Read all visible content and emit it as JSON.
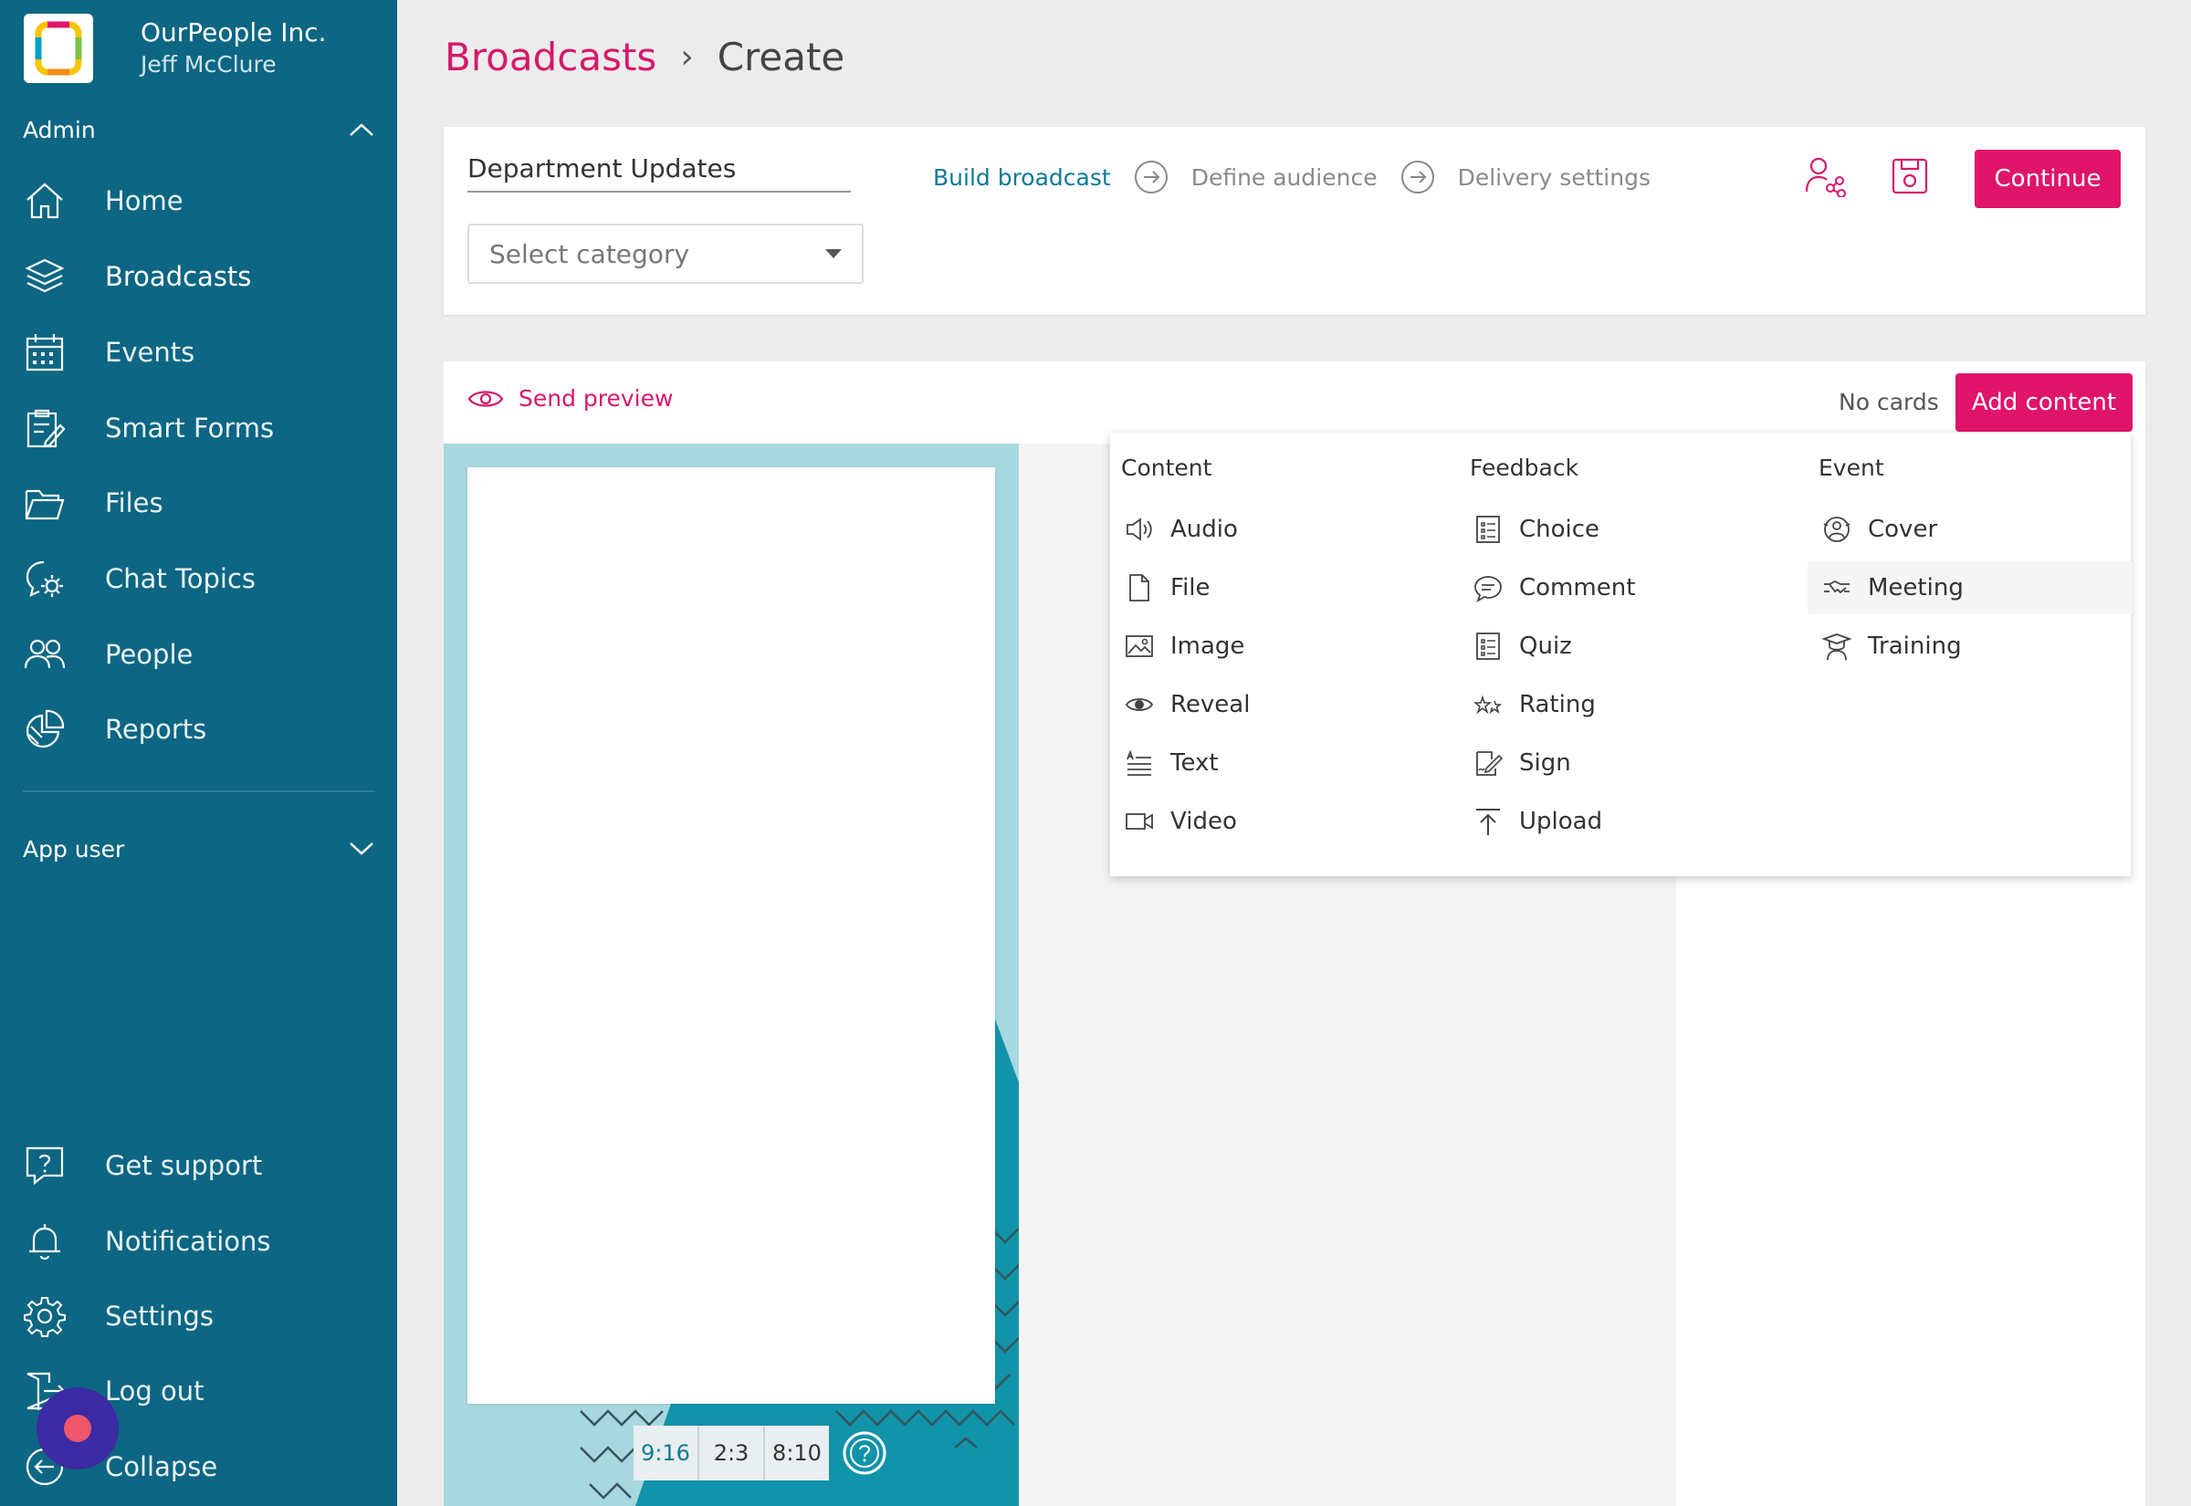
{
  "org": {
    "name": "OurPeople Inc.",
    "user": "Jeff McClure"
  },
  "sidebar": {
    "admin_label": "Admin",
    "items": [
      {
        "label": "Home",
        "icon": "home-icon"
      },
      {
        "label": "Broadcasts",
        "icon": "layers-icon"
      },
      {
        "label": "Events",
        "icon": "calendar-icon"
      },
      {
        "label": "Smart Forms",
        "icon": "form-icon"
      },
      {
        "label": "Files",
        "icon": "folder-icon"
      },
      {
        "label": "Chat Topics",
        "icon": "chat-settings-icon"
      },
      {
        "label": "People",
        "icon": "people-icon"
      },
      {
        "label": "Reports",
        "icon": "pie-chart-icon"
      }
    ],
    "app_user_label": "App user",
    "bottom": [
      {
        "label": "Get support",
        "icon": "help-icon"
      },
      {
        "label": "Notifications",
        "icon": "bell-icon"
      },
      {
        "label": "Settings",
        "icon": "gear-icon"
      },
      {
        "label": "Log out",
        "icon": "logout-icon"
      },
      {
        "label": "Collapse",
        "icon": "collapse-icon"
      }
    ]
  },
  "breadcrumb": {
    "parent": "Broadcasts",
    "current": "Create"
  },
  "form": {
    "title_value": "Department Updates",
    "category_placeholder": "Select category"
  },
  "steps": [
    "Build broadcast",
    "Define audience",
    "Delivery settings"
  ],
  "toolbar": {
    "continue_label": "Continue"
  },
  "content_bar": {
    "send_preview": "Send preview",
    "no_cards": "No cards",
    "add_content": "Add content"
  },
  "ratios": [
    "9:16",
    "2:3",
    "8:10"
  ],
  "dropdown": {
    "columns": [
      {
        "title": "Content",
        "items": [
          "Audio",
          "File",
          "Image",
          "Reveal",
          "Text",
          "Video"
        ]
      },
      {
        "title": "Feedback",
        "items": [
          "Choice",
          "Comment",
          "Quiz",
          "Rating",
          "Sign",
          "Upload"
        ]
      },
      {
        "title": "Event",
        "items": [
          "Cover",
          "Meeting",
          "Training"
        ]
      }
    ]
  },
  "colors": {
    "sidebar": "#0d6683",
    "accent": "#e0146a",
    "link": "#d6186b",
    "step_active": "#0d7a97"
  }
}
